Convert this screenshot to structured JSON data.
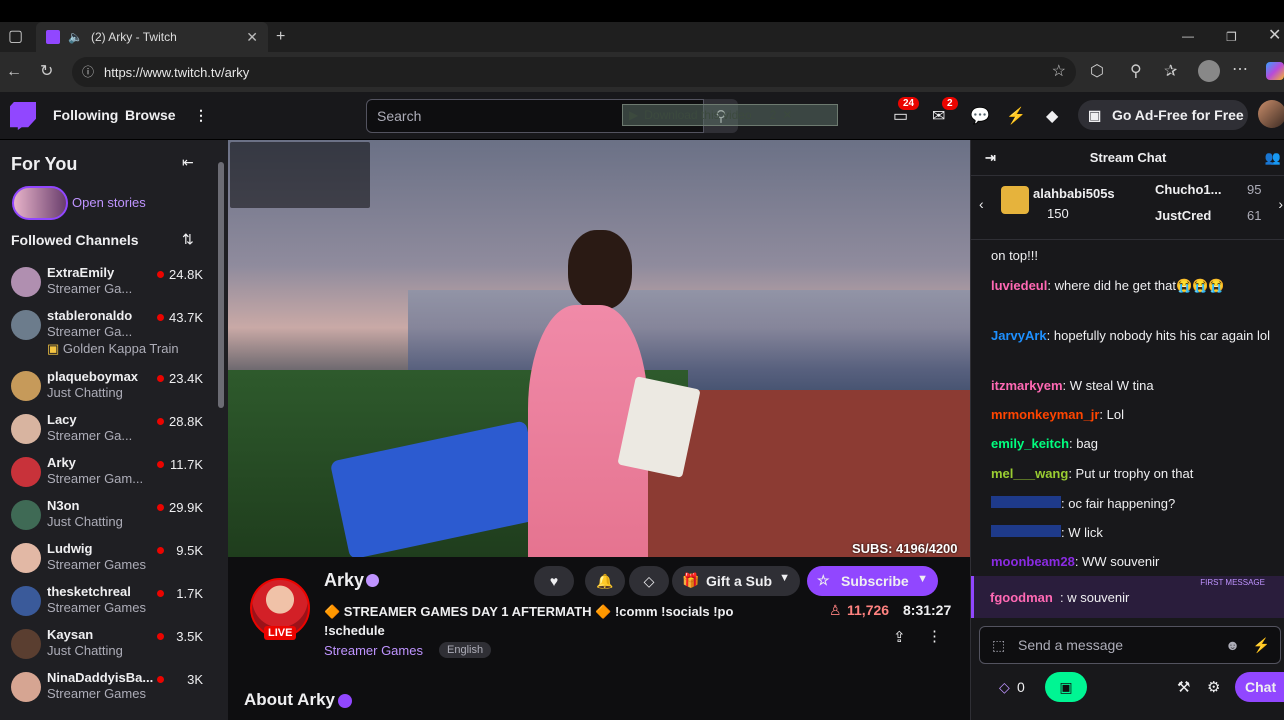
{
  "browser": {
    "tab_title": "(2) Arky - Twitch",
    "url": "https://www.twitch.tv/arky"
  },
  "header": {
    "nav_following": "Following",
    "nav_browse": "Browse",
    "search_placeholder": "Search",
    "download_overlay": "Download this video",
    "download_count": "2",
    "inbox_badge": "24",
    "whispers_badge": "2",
    "ad_free_label": "Go Ad-Free for Free"
  },
  "sidebar": {
    "title": "For You",
    "stories_label": "Open stories",
    "followed_title": "Followed Channels",
    "channels": [
      {
        "name": "ExtraEmily",
        "category": "Streamer Ga...",
        "viewers": "24.8K"
      },
      {
        "name": "stableronaldo",
        "category": "Streamer Ga...",
        "extra": "Golden Kappa Train",
        "viewers": "43.7K"
      },
      {
        "name": "plaqueboymax",
        "category": "Just Chatting",
        "viewers": "23.4K"
      },
      {
        "name": "Lacy",
        "category": "Streamer Ga...",
        "viewers": "28.8K"
      },
      {
        "name": "Arky",
        "category": "Streamer Gam...",
        "viewers": "11.7K"
      },
      {
        "name": "N3on",
        "category": "Just Chatting",
        "viewers": "29.9K"
      },
      {
        "name": "Ludwig",
        "category": "Streamer Games",
        "viewers": "9.5K"
      },
      {
        "name": "thesketchreal",
        "category": "Streamer Games",
        "viewers": "1.7K"
      },
      {
        "name": "Kaysan",
        "category": "Just Chatting",
        "viewers": "3.5K"
      },
      {
        "name": "NinaDaddyisBa...",
        "category": "Streamer Games",
        "viewers": "3K"
      }
    ]
  },
  "video": {
    "subs_overlay": "SUBS: 4196/4200"
  },
  "stream": {
    "streamer": "Arky",
    "live_label": "LIVE",
    "title_line1": "🔶 STREAMER GAMES DAY 1 AFTERMATH 🔶 !comm !socials !po",
    "title_line2": "!schedule",
    "game": "Streamer Games",
    "language": "English",
    "gift_label": "Gift a Sub",
    "subscribe_label": "Subscribe",
    "viewer_count": "11,726",
    "uptime": "8:31:27",
    "about_title": "About Arky"
  },
  "chat": {
    "header": "Stream Chat",
    "gifters": [
      {
        "name": "alahbabi505s",
        "count": "150"
      },
      {
        "name": "Chucho1...",
        "count": "95"
      },
      {
        "name": "JustCred",
        "count": "61"
      }
    ],
    "messages": [
      {
        "user": "",
        "color": "#efeff1",
        "text": "on top!!!"
      },
      {
        "user": "luviedeul",
        "color": "#ff69b4",
        "text": ": where did he get that😭😭😭"
      },
      {
        "user": "JarvyArk",
        "color": "#1e90ff",
        "text": ": hopefully nobody hits his car again lol"
      },
      {
        "user": "itzmarkyem",
        "color": "#ff69b4",
        "text": ": W steal W tina"
      },
      {
        "user": "mrmonkeyman_jr",
        "color": "#ff4500",
        "text": ": Lol"
      },
      {
        "user": "emily_keitch",
        "color": "#00ff7f",
        "text": ": bag"
      },
      {
        "user": "mel___wang",
        "color": "#9acd32",
        "text": ": Put ur trophy on that"
      },
      {
        "user": "",
        "color": "#1e90ff",
        "text": ": oc fair happening?"
      },
      {
        "user": "",
        "color": "#1e90ff",
        "text": ": W lick"
      },
      {
        "user": "moonbeam28",
        "color": "#8a2be2",
        "text": ": WW souvenir"
      }
    ],
    "first_message_label": "FIRST MESSAGE",
    "highlight_user": "fgoodman",
    "highlight_text": ": w souvenir",
    "input_placeholder": "Send a message",
    "points": "0",
    "chat_button": "Chat"
  }
}
